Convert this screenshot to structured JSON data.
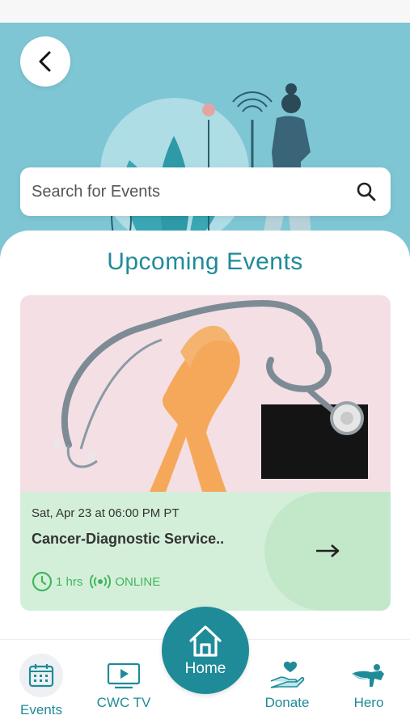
{
  "header": {
    "back_icon": "chevron-left-icon",
    "search_placeholder": "Search for Events",
    "search_icon": "search-icon"
  },
  "section_title": "Upcoming Events",
  "event": {
    "date": "Sat, Apr 23 at 06:00 PM PT",
    "title": "Cancer-Diagnostic Service..",
    "duration": "1 hrs",
    "mode": "ONLINE",
    "arrow_icon": "arrow-right-icon"
  },
  "nav": {
    "events_label": "Events",
    "tv_label": "CWC TV",
    "home_label": "Home",
    "donate_label": "Donate",
    "hero_label": "Hero"
  },
  "colors": {
    "accent": "#1f8b98",
    "hero_bg": "#7ec6d4",
    "online_green": "#3fb65c",
    "card_info_bg": "#d4efd9"
  }
}
